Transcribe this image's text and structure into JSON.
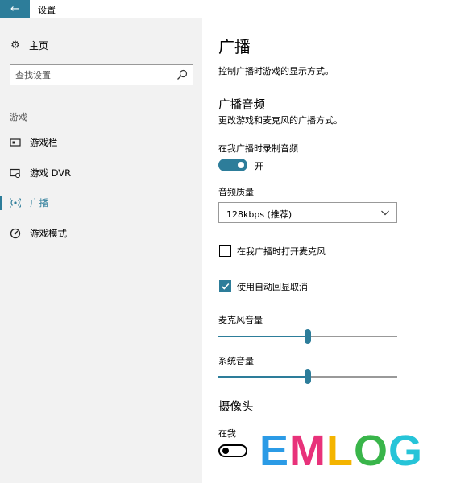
{
  "window": {
    "title": "设置",
    "back_icon": "arrow-left-icon"
  },
  "sidebar": {
    "home_label": "主页",
    "search_placeholder": "查找设置",
    "section_label": "游戏",
    "items": [
      {
        "label": "游戏栏",
        "icon": "gamebar-icon",
        "active": false
      },
      {
        "label": "游戏 DVR",
        "icon": "dvr-icon",
        "active": false
      },
      {
        "label": "广播",
        "icon": "broadcast-icon",
        "active": true
      },
      {
        "label": "游戏模式",
        "icon": "gamemode-icon",
        "active": false
      }
    ]
  },
  "main": {
    "title": "广播",
    "description": "控制广播时游戏的显示方式。",
    "audio_section": {
      "title": "广播音频",
      "description": "更改游戏和麦克风的广播方式。",
      "record_audio_label": "在我广播时录制音频",
      "record_audio_state": "开",
      "record_audio_on": true,
      "quality_label": "音频质量",
      "quality_value": "128kbps (推荐)",
      "mic_checkbox_label": "在我广播时打开麦克风",
      "mic_checkbox_checked": false,
      "echo_checkbox_label": "使用自动回显取消",
      "echo_checkbox_checked": true,
      "mic_volume_label": "麦克风音量",
      "mic_volume_value": 0.5,
      "system_volume_label": "系统音量",
      "system_volume_value": 0.5
    },
    "camera_section": {
      "title": "摄像头",
      "partial_label": "在我",
      "toggle_on": false
    }
  },
  "watermark": {
    "letters": [
      {
        "char": "E",
        "color": "#2b9be6"
      },
      {
        "char": "M",
        "color": "#e8327a"
      },
      {
        "char": "L",
        "color": "#f4b400"
      },
      {
        "char": "O",
        "color": "#39b54a"
      },
      {
        "char": "G",
        "color": "#26c4d8"
      }
    ]
  },
  "colors": {
    "accent": "#2d7d9a",
    "sidebar_bg": "#f2f2f2"
  }
}
